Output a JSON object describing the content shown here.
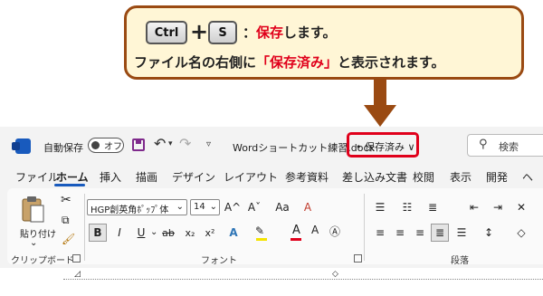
{
  "callout": {
    "key1": "Ctrl",
    "plus": "+",
    "key2": "S",
    "line1_colon": "：",
    "line1_red": "保存",
    "line1_rest": "します。",
    "line2_pre": "ファイル名の右側に",
    "line2_red": "「保存済み」",
    "line2_post": "と表示されます。",
    "border_color": "#9a4a12",
    "highlight_color": "#e0001b"
  },
  "titlebar": {
    "autosave_label": "自動保存",
    "autosave_state": "オフ",
    "doc_title": "Wordショートカット練習.docx",
    "save_status": "• 保存済み ∨",
    "search_placeholder": "検索",
    "icons": [
      "word-icon",
      "save-icon",
      "undo-icon",
      "redo-icon",
      "search-icon"
    ]
  },
  "tabs": [
    "ファイル",
    "ホーム",
    "挿入",
    "描画",
    "デザイン",
    "レイアウト",
    "参考資料",
    "差し込み文書",
    "校閲",
    "表示",
    "開発",
    "ヘ"
  ],
  "ribbon": {
    "clipboard": {
      "paste": "貼り付け",
      "label": "クリップボード"
    },
    "font": {
      "font_name": "HGP創英角ﾎﾟｯﾌﾟ体",
      "font_size": "14",
      "grow": "A^",
      "shrink": "Aˇ",
      "case": "Aa",
      "clear": "A",
      "bold": "B",
      "italic": "I",
      "underline": "U",
      "strike": "ab",
      "sub": "x₂",
      "sup": "x²",
      "label": "フォント"
    },
    "paragraph": {
      "label": "段落"
    }
  }
}
